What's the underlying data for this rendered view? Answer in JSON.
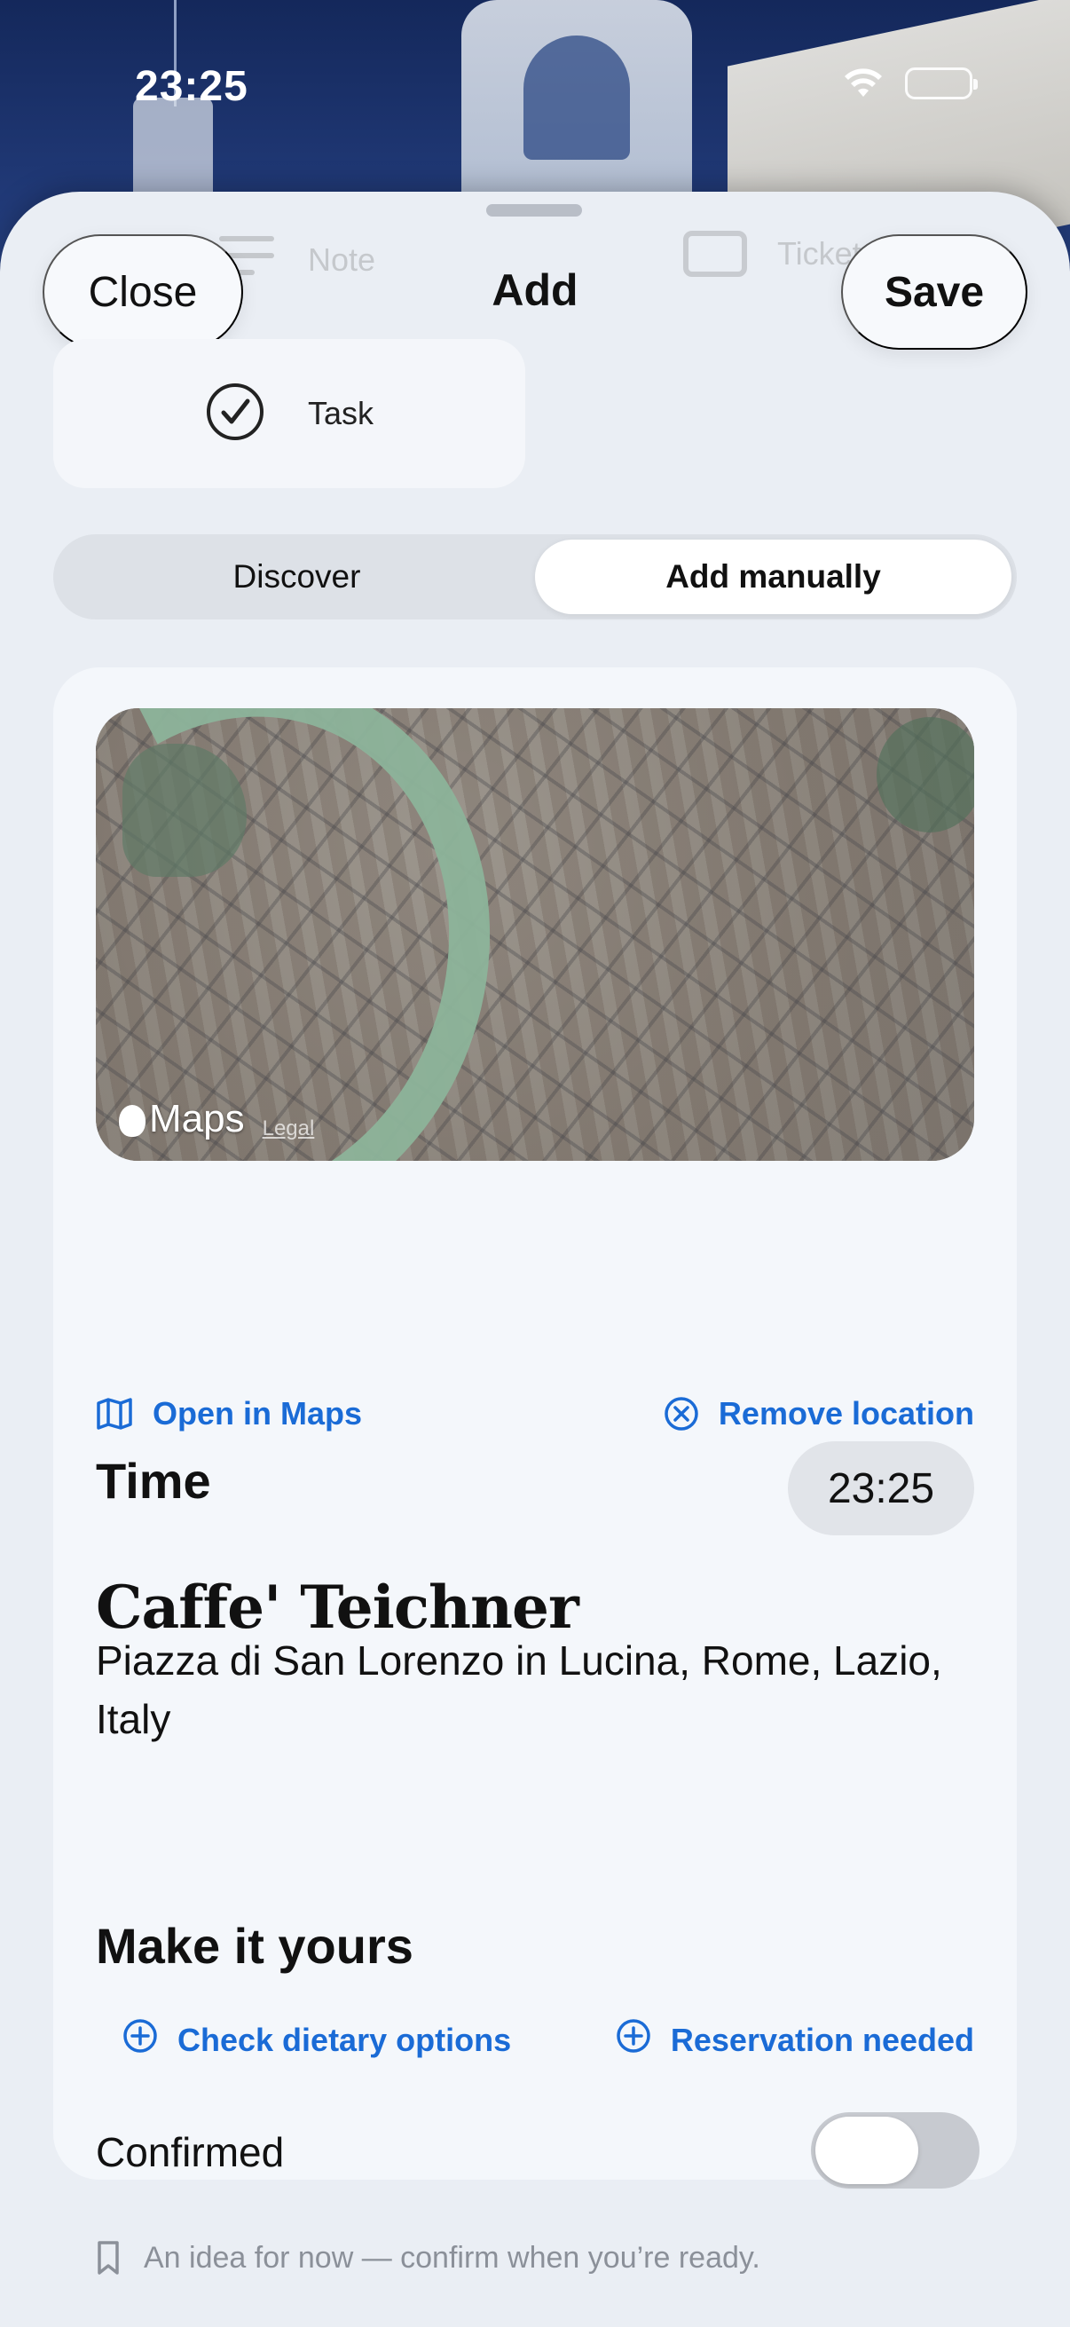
{
  "status_bar": {
    "time": "23:25"
  },
  "header": {
    "close_label": "Close",
    "title": "Add",
    "save_label": "Save"
  },
  "type_selector": {
    "items": [
      {
        "label": "Note",
        "icon": "note-icon"
      },
      {
        "label": "Ticket",
        "icon": "ticket-icon"
      },
      {
        "label": "Task",
        "icon": "checkmark-circle-icon",
        "selected": true
      }
    ]
  },
  "mode_switch": {
    "tabs": [
      {
        "label": "Discover",
        "active": false
      },
      {
        "label": "Add manually",
        "active": true
      }
    ]
  },
  "location": {
    "map_brand": "Maps",
    "map_legal": "Legal",
    "open_in_maps": "Open in Maps",
    "remove_location": "Remove location"
  },
  "time": {
    "label": "Time",
    "value": "23:25"
  },
  "place": {
    "name": "Caffe' Teichner",
    "address": "Piazza di San Lorenzo in Lucina, Rome, Lazio, Italy"
  },
  "personalize": {
    "title": "Make it yours",
    "suggestions": [
      "Check dietary options",
      "Reservation needed"
    ]
  },
  "confirmation": {
    "label": "Confirmed",
    "confirmed": false,
    "hint": "An idea for now — confirm when you’re ready."
  },
  "colors": {
    "accent": "#1a6bd6",
    "sheet_bg": "#eaeef4",
    "card_bg": "#f4f7fb"
  }
}
